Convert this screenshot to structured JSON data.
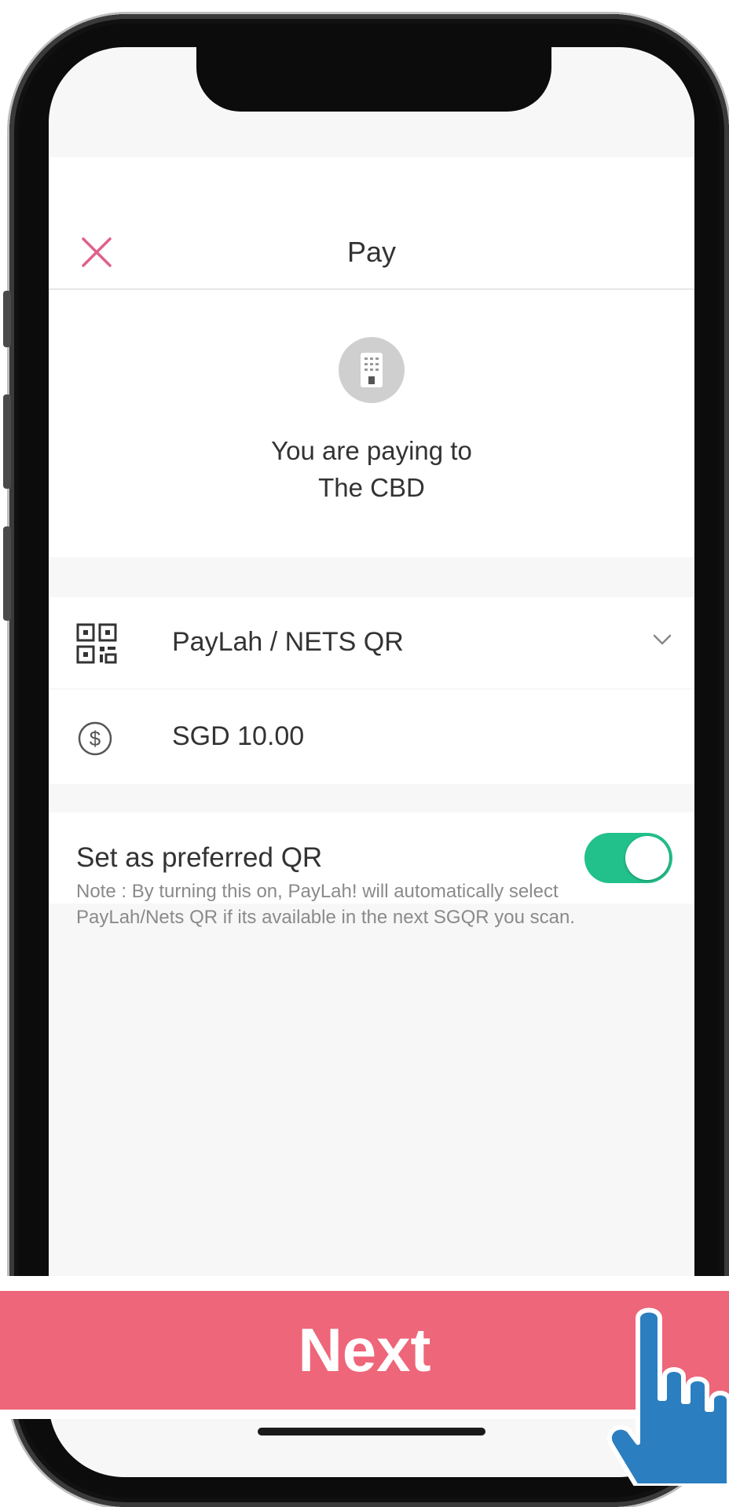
{
  "header": {
    "title": "Pay",
    "close_icon": "close-icon"
  },
  "payee": {
    "avatar_icon": "merchant-building-icon",
    "line1": "You are paying to",
    "line2": "The CBD"
  },
  "payment_method": {
    "icon": "qr-code-icon",
    "label": "PayLah / NETS QR",
    "dropdown_icon": "chevron-down-icon"
  },
  "amount": {
    "icon": "dollar-coin-icon",
    "value": "SGD 10.00"
  },
  "preferred_qr": {
    "label": "Set as preferred QR",
    "enabled": true
  },
  "note": "Note : By turning this on, PayLah! will automatically select PayLah/Nets QR if its available in the next SGQR you scan.",
  "next_button": {
    "label": "Next"
  },
  "colors": {
    "accent_pink": "#ee6679",
    "close_pink": "#e0608a",
    "toggle_green": "#22c08b",
    "hand_blue": "#2b7fc1"
  },
  "pointer_icon": "pointing-hand-icon"
}
